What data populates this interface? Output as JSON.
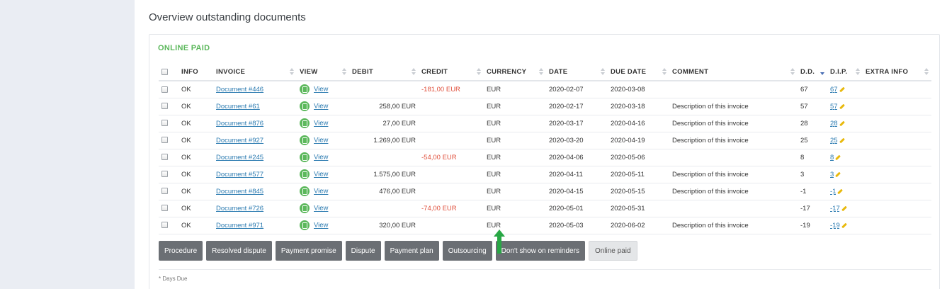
{
  "page": {
    "title": "Overview outstanding documents"
  },
  "section": {
    "title": "ONLINE PAID"
  },
  "table": {
    "headers": {
      "info": "INFO",
      "invoice": "INVOICE",
      "view": "VIEW",
      "debit": "DEBIT",
      "credit": "CREDIT",
      "currency": "CURRENCY",
      "date": "DATE",
      "due_date": "DUE DATE",
      "comment": "COMMENT",
      "dd": "D.D.",
      "dip": "D.I.P.",
      "extra_info": "EXTRA INFO"
    },
    "rows": [
      {
        "info": "OK",
        "invoice": "Document #446",
        "view": "View",
        "debit": "",
        "credit": "-181,00 EUR",
        "currency": "EUR",
        "date": "2020-02-07",
        "due_date": "2020-03-08",
        "comment": "",
        "dd": "67",
        "dip": "67",
        "extra_info": ""
      },
      {
        "info": "OK",
        "invoice": "Document #61",
        "view": "View",
        "debit": "258,00 EUR",
        "credit": "",
        "currency": "EUR",
        "date": "2020-02-17",
        "due_date": "2020-03-18",
        "comment": "Description of this invoice",
        "dd": "57",
        "dip": "57",
        "extra_info": ""
      },
      {
        "info": "OK",
        "invoice": "Document #876",
        "view": "View",
        "debit": "27,00 EUR",
        "credit": "",
        "currency": "EUR",
        "date": "2020-03-17",
        "due_date": "2020-04-16",
        "comment": "Description of this invoice",
        "dd": "28",
        "dip": "28",
        "extra_info": ""
      },
      {
        "info": "OK",
        "invoice": "Document #927",
        "view": "View",
        "debit": "1.269,00 EUR",
        "credit": "",
        "currency": "EUR",
        "date": "2020-03-20",
        "due_date": "2020-04-19",
        "comment": "Description of this invoice",
        "dd": "25",
        "dip": "25",
        "extra_info": ""
      },
      {
        "info": "OK",
        "invoice": "Document #245",
        "view": "View",
        "debit": "",
        "credit": "-54,00 EUR",
        "currency": "EUR",
        "date": "2020-04-06",
        "due_date": "2020-05-06",
        "comment": "",
        "dd": "8",
        "dip": "8",
        "extra_info": ""
      },
      {
        "info": "OK",
        "invoice": "Document #577",
        "view": "View",
        "debit": "1.575,00 EUR",
        "credit": "",
        "currency": "EUR",
        "date": "2020-04-11",
        "due_date": "2020-05-11",
        "comment": "Description of this invoice",
        "dd": "3",
        "dip": "3",
        "extra_info": ""
      },
      {
        "info": "OK",
        "invoice": "Document #845",
        "view": "View",
        "debit": "476,00 EUR",
        "credit": "",
        "currency": "EUR",
        "date": "2020-04-15",
        "due_date": "2020-05-15",
        "comment": "Description of this invoice",
        "dd": "-1",
        "dip": "-1",
        "extra_info": ""
      },
      {
        "info": "OK",
        "invoice": "Document #726",
        "view": "View",
        "debit": "",
        "credit": "-74,00 EUR",
        "currency": "EUR",
        "date": "2020-05-01",
        "due_date": "2020-05-31",
        "comment": "",
        "dd": "-17",
        "dip": "-17",
        "extra_info": ""
      },
      {
        "info": "OK",
        "invoice": "Document #971",
        "view": "View",
        "debit": "320,00 EUR",
        "credit": "",
        "currency": "EUR",
        "date": "2020-05-03",
        "due_date": "2020-06-02",
        "comment": "Description of this invoice",
        "dd": "-19",
        "dip": "-19",
        "extra_info": ""
      }
    ]
  },
  "buttons": {
    "procedure": "Procedure",
    "resolved_dispute": "Resolved dispute",
    "payment_promise": "Payment promise",
    "dispute": "Dispute",
    "payment_plan": "Payment plan",
    "outsourcing": "Outsourcing",
    "dont_show": "Don't show on reminders",
    "online_paid": "Online paid"
  },
  "footnote": "* Days Due",
  "icons": {
    "view": "pdf-icon",
    "dip_edit": "pencil-icon",
    "indicator": "arrow-up-icon"
  },
  "colors": {
    "accent_green": "#5cb85c",
    "credit_red": "#e0503c",
    "link_blue": "#2a7ab0",
    "button_dark": "#6b6f74",
    "indicator_green": "#28a745"
  }
}
